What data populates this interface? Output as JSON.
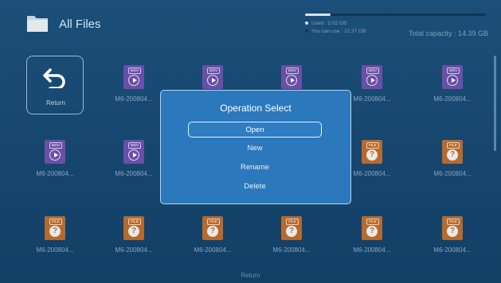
{
  "header": {
    "title": "All Files",
    "storage": {
      "used_label": "Used : 2.02 GB",
      "free_label": "You can use : 12.37 GB",
      "total_label": "Total capacity : 14.39 GB",
      "used_fraction": 0.14,
      "colors": {
        "used": "#d8e3ec",
        "free": "#0f3556"
      }
    }
  },
  "grid": {
    "return_tile": {
      "label": "Return",
      "icon": "return-arrow-icon"
    },
    "items": [
      {
        "type": "MOV",
        "icon": "video-file-icon",
        "name": "M6-200804..."
      },
      {
        "type": "MOV",
        "icon": "video-file-icon",
        "name": ""
      },
      {
        "type": "MOV",
        "icon": "video-file-icon",
        "name": ""
      },
      {
        "type": "MOV",
        "icon": "video-file-icon",
        "name": "M6-200804..."
      },
      {
        "type": "MOV",
        "icon": "video-file-icon",
        "name": "M6-200804..."
      },
      {
        "type": "MOV",
        "icon": "video-file-icon",
        "name": "M6-200804..."
      },
      {
        "type": "MOV",
        "icon": "video-file-icon",
        "name": "M6-200804..."
      },
      {
        "type": "FILE",
        "icon": "unknown-file-icon",
        "name": "M6-200804..."
      },
      {
        "type": "FILE",
        "icon": "unknown-file-icon",
        "name": "M6-200804..."
      },
      {
        "type": "FILE",
        "icon": "unknown-file-icon",
        "name": "M6-200804..."
      },
      {
        "type": "FILE",
        "icon": "unknown-file-icon",
        "name": "M6-200804..."
      },
      {
        "type": "FILE",
        "icon": "unknown-file-icon",
        "name": "M6-200804..."
      },
      {
        "type": "FILE",
        "icon": "unknown-file-icon",
        "name": "M6-200804..."
      },
      {
        "type": "FILE",
        "icon": "unknown-file-icon",
        "name": "M6-200804..."
      },
      {
        "type": "FILE",
        "icon": "unknown-file-icon",
        "name": "M6-200804..."
      }
    ]
  },
  "footer": {
    "return_label": "Return"
  },
  "dialog": {
    "title": "Operation Select",
    "options": [
      "Open",
      "New",
      "Rename",
      "Delete"
    ],
    "selected": "Open"
  }
}
